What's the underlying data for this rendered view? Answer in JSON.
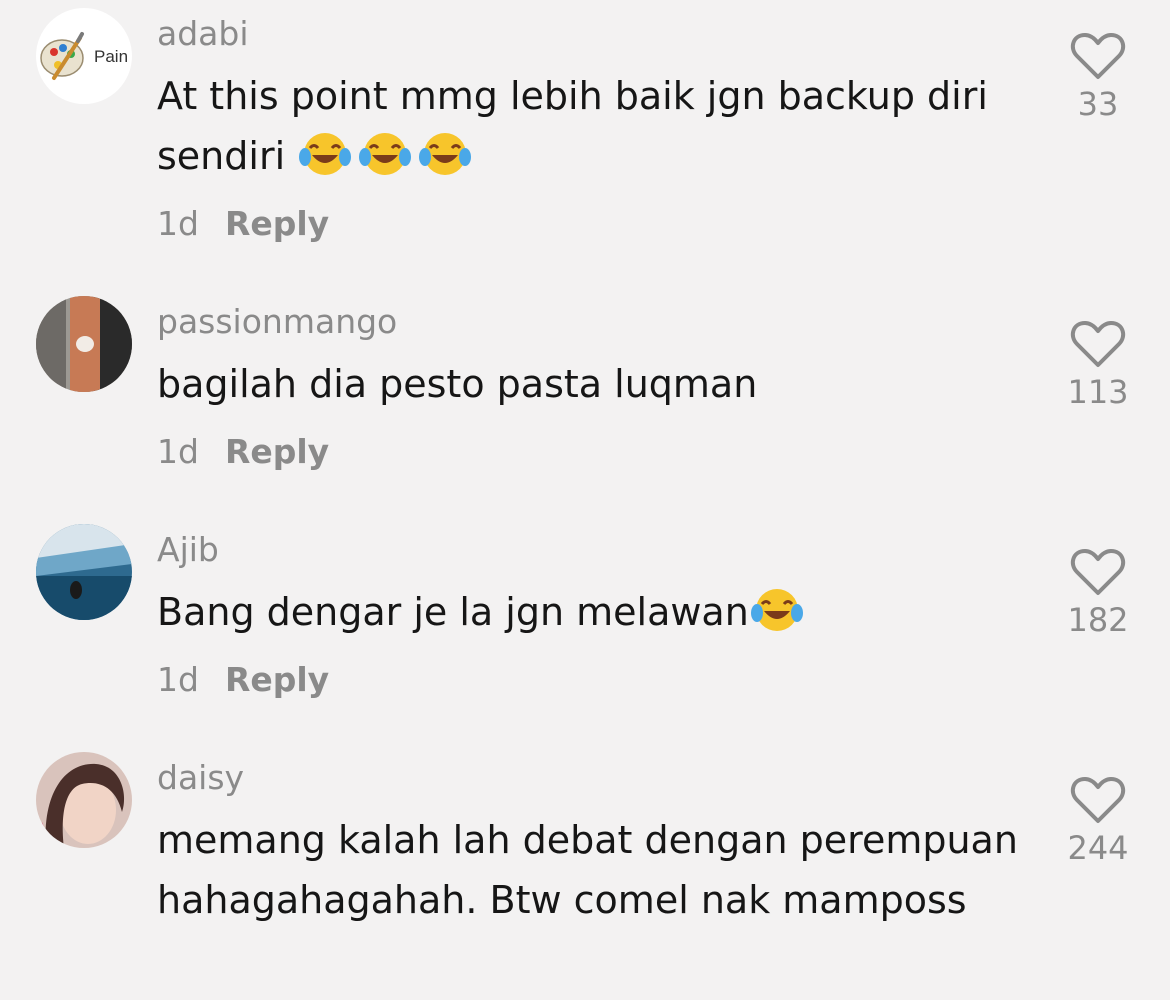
{
  "comments": [
    {
      "username": "adabi",
      "text": "At this point mmg lebih baik jgn backup diri sendiri",
      "emoji_count": 3,
      "time": "1d",
      "reply_label": "Reply",
      "likes": "33",
      "avatar": {
        "icon": "paint-palette-icon",
        "label": "Pain",
        "bg": "#ffffff"
      }
    },
    {
      "username": "passionmango",
      "text": "bagilah dia pesto pasta luqman",
      "time": "1d",
      "reply_label": "Reply",
      "likes": "113",
      "avatar": {
        "icon": "photo-avatar"
      }
    },
    {
      "username": "Ajib",
      "text": "Bang dengar je la jgn melawan",
      "emoji_count": 1,
      "time": "1d",
      "reply_label": "Reply",
      "likes": "182",
      "avatar": {
        "icon": "photo-avatar"
      }
    },
    {
      "username": "daisy",
      "text": "memang kalah lah debat dengan perempuan hahagahagahah. Btw comel nak mamposs",
      "time": "",
      "reply_label": "",
      "likes": "244",
      "avatar": {
        "icon": "photo-avatar"
      }
    }
  ],
  "icons": {
    "like": "heart-outline-icon",
    "emoji": "face-with-tears-of-joy-icon"
  },
  "colors": {
    "background": "#f3f2f2",
    "username": "#8a8a8a",
    "text": "#161616"
  }
}
